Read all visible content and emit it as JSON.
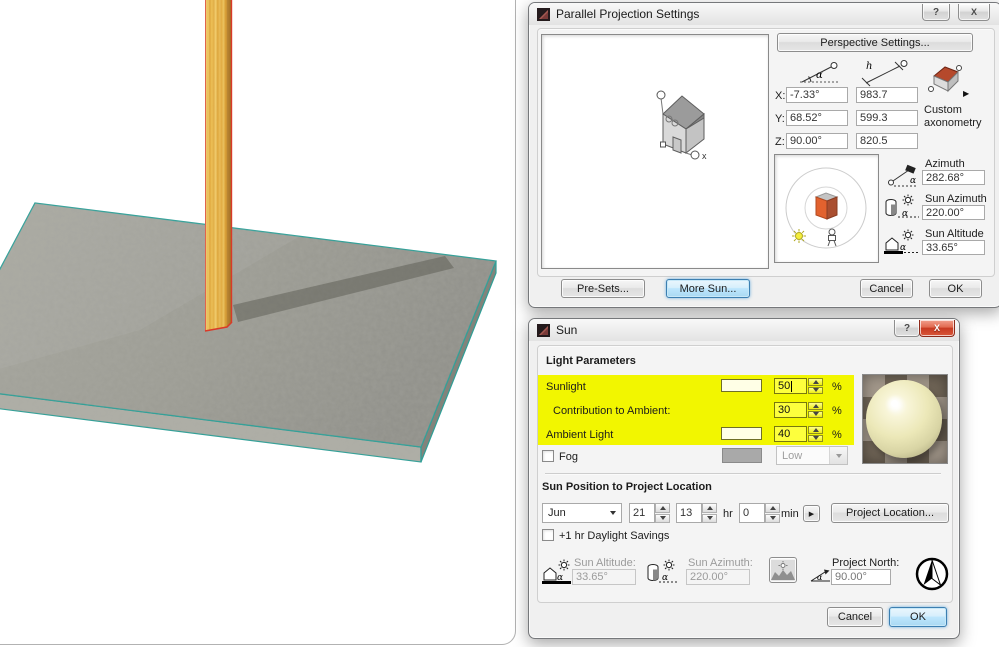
{
  "icons": {
    "help": "?",
    "close": "X",
    "alpha": "α",
    "h": "h",
    "x_axis": "x",
    "play": "▶",
    "flyout_arrow": "▶"
  },
  "colors": {
    "highlight_yellow": "#f2f600",
    "selection_red": "#d93a28",
    "slab_edge_teal": "#2f9f97",
    "wood_face": "#eebd50",
    "wood_side": "#a87a30",
    "concrete": "#9f9f97",
    "default_button_blue": "#3c7fb1",
    "close_button_red": "#c83a22"
  },
  "pps": {
    "title": "Parallel Projection Settings",
    "perspective_button": "Perspective Settings...",
    "axes": {
      "rows": [
        {
          "label": "X:",
          "angle": "-7.33°",
          "length": "983.7"
        },
        {
          "label": "Y:",
          "angle": "68.52°",
          "length": "599.3"
        },
        {
          "label": "Z:",
          "angle": "90.00°",
          "length": "820.5"
        }
      ]
    },
    "custom_axonometry": "Custom axonometry",
    "azimuth": {
      "label": "Azimuth",
      "value": "282.68°"
    },
    "sun_azimuth": {
      "label": "Sun Azimuth",
      "value": "220.00°"
    },
    "sun_altitude": {
      "label": "Sun Altitude",
      "value": "33.65°"
    },
    "presets_button": "Pre-Sets...",
    "more_sun_button": "More Sun...",
    "cancel_button": "Cancel",
    "ok_button": "OK"
  },
  "sun": {
    "title": "Sun",
    "light_parameters": {
      "header": "Light Parameters",
      "sunlight": {
        "label": "Sunlight",
        "value": "50",
        "unit": "%"
      },
      "contribution": {
        "label": "Contribution to Ambient:",
        "value": "30",
        "unit": "%"
      },
      "ambient": {
        "label": "Ambient Light",
        "value": "40",
        "unit": "%"
      },
      "fog": {
        "label": "Fog",
        "level": "Low"
      }
    },
    "sun_position": {
      "header": "Sun Position to Project Location",
      "month": "Jun",
      "day": "21",
      "hour": "13",
      "hour_unit": "hr",
      "minute": "0",
      "minute_unit": "min",
      "project_location_button": "Project Location...",
      "daylight_savings": "+1 hr Daylight Savings"
    },
    "readouts": {
      "sun_altitude": {
        "label": "Sun Altitude:",
        "value": "33.65°"
      },
      "sun_azimuth": {
        "label": "Sun Azimuth:",
        "value": "220.00°"
      },
      "project_north": {
        "label": "Project North:",
        "value": "90.00°"
      }
    },
    "cancel_button": "Cancel",
    "ok_button": "OK"
  }
}
